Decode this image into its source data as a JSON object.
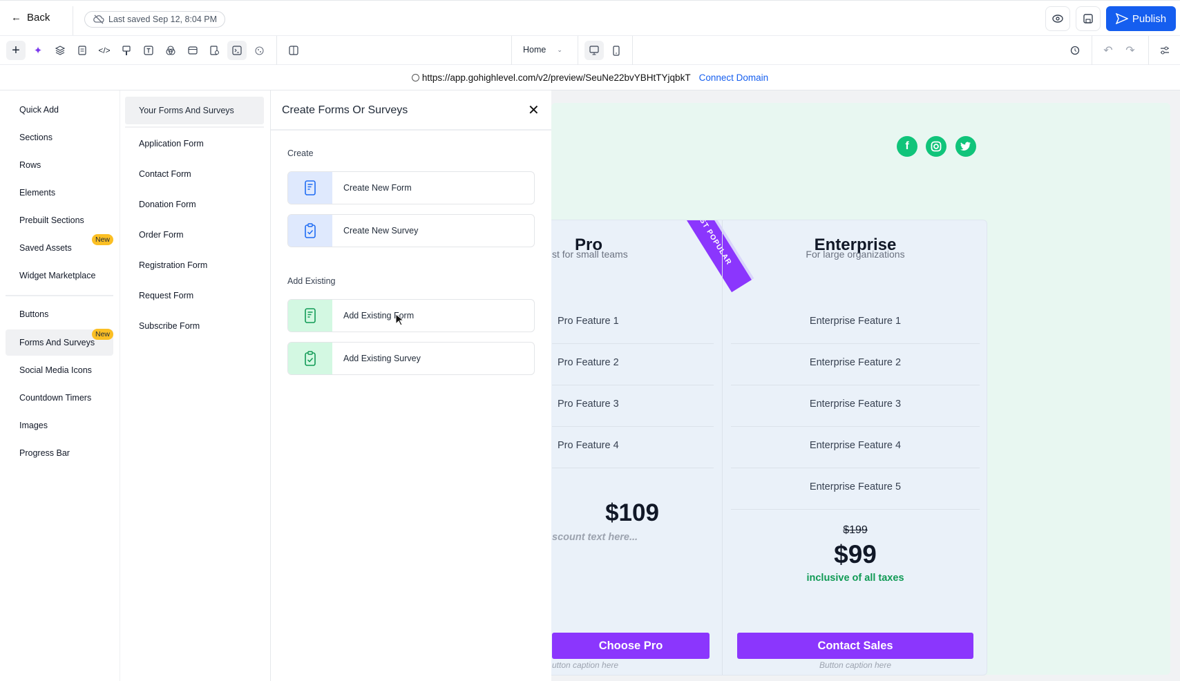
{
  "topbar": {
    "back_label": "Back",
    "saved_status": "Last saved Sep 12, 8:04 PM",
    "publish_label": "Publish"
  },
  "toolbar": {
    "page_select": "Home",
    "tools": [
      "plus-icon",
      "sparkle-icon",
      "layers-icon",
      "page-icon",
      "code-icon",
      "paint-brush-icon",
      "text-icon",
      "color-blend-icon",
      "layout-icon",
      "form-search-icon",
      "terminal-icon",
      "cookie-icon"
    ]
  },
  "urlbar": {
    "url": "https://app.gohighlevel.com/v2/preview/SeuNe22bvYBHtTYjqbkT",
    "connect_label": "Connect Domain"
  },
  "sidebar": {
    "items": [
      {
        "label": "Quick Add"
      },
      {
        "label": "Sections"
      },
      {
        "label": "Rows"
      },
      {
        "label": "Elements"
      },
      {
        "label": "Prebuilt Sections"
      },
      {
        "label": "Saved Assets",
        "badge": "New"
      },
      {
        "label": "Widget Marketplace"
      },
      {
        "label": "Buttons"
      },
      {
        "label": "Forms And Surveys",
        "badge": "New",
        "active": true
      },
      {
        "label": "Social Media Icons"
      },
      {
        "label": "Countdown Timers"
      },
      {
        "label": "Images"
      },
      {
        "label": "Progress Bar"
      }
    ]
  },
  "forms_list": {
    "header": "Your Forms And Surveys",
    "items": [
      "Application Form",
      "Contact Form",
      "Donation Form",
      "Order Form",
      "Registration Form",
      "Request Form",
      "Subscribe Form"
    ]
  },
  "panel": {
    "title": "Create Forms Or Surveys",
    "create_label": "Create",
    "create_form": "Create New Form",
    "create_survey": "Create New Survey",
    "existing_label": "Add Existing",
    "existing_form": "Add Existing Form",
    "existing_survey": "Add Existing Survey"
  },
  "canvas": {
    "social": [
      "facebook-icon",
      "instagram-icon",
      "twitter-icon"
    ],
    "pro": {
      "title": "Pro",
      "subtitle_visible": "st for small teams",
      "ribbon": "MOST POPULAR",
      "features": [
        "Pro Feature 1",
        "Pro Feature 2",
        "Pro Feature 3",
        "Pro Feature 4"
      ],
      "price": "$109",
      "discount_visible": "scount text here...",
      "cta": "Choose Pro",
      "caption_visible": "utton caption here"
    },
    "enterprise": {
      "title": "Enterprise",
      "subtitle": "For large organizations",
      "features": [
        "Enterprise Feature 1",
        "Enterprise Feature 2",
        "Enterprise Feature 3",
        "Enterprise Feature 4",
        "Enterprise Feature 5"
      ],
      "old_price": "$199",
      "price": "$99",
      "tax_note": "inclusive of all taxes",
      "cta": "Contact Sales",
      "caption": "Button caption here"
    }
  },
  "colors": {
    "primary": "#155eef",
    "cta": "#8b36fd",
    "social": "#10c47a",
    "badge": "#fbbf24",
    "canvas_bg": "#e8f7f1"
  }
}
